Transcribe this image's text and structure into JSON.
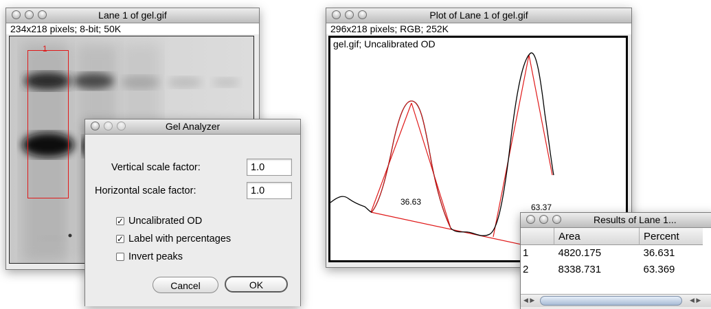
{
  "lane_window": {
    "title": "Lane 1 of gel.gif",
    "info": "234x218 pixels; 8-bit; 50K",
    "lane_label": "1"
  },
  "plot_window": {
    "title": "Plot of Lane 1 of gel.gif",
    "info": "296x218 pixels; RGB; 252K",
    "plot_label": "gel.gif; Uncalibrated OD",
    "peak_labels": [
      "36.63",
      "63.37"
    ]
  },
  "gel_analyzer": {
    "title": "Gel Analyzer",
    "vertical_label": "Vertical scale factor:",
    "vertical_value": "1.0",
    "horizontal_label": "Horizontal scale factor:",
    "horizontal_value": "1.0",
    "checkboxes": [
      {
        "label": "Uncalibrated OD",
        "checked": true
      },
      {
        "label": "Label with percentages",
        "checked": true
      },
      {
        "label": "Invert peaks",
        "checked": false
      }
    ],
    "cancel_label": "Cancel",
    "ok_label": "OK"
  },
  "results_window": {
    "title": "Results of Lane 1...",
    "columns": [
      "",
      "Area",
      "Percent"
    ],
    "rows": [
      [
        "1",
        "4820.175",
        "36.631"
      ],
      [
        "2",
        "8338.731",
        "63.369"
      ]
    ]
  },
  "colors": {
    "selection_red": "#e01818",
    "profile_black": "#000000",
    "titlebar": "#c9c9c9"
  }
}
